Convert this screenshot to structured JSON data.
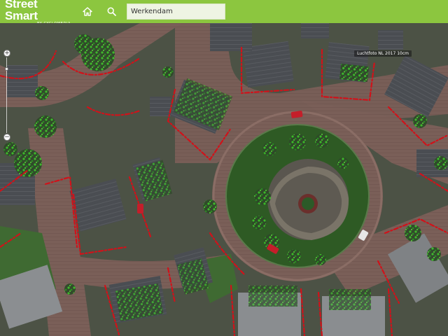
{
  "app": {
    "brand_name": "Street Smart",
    "brand_sub": "BY CYCLOMEDIA",
    "accent_color": "#8cc63f"
  },
  "toolbar": {
    "home_icon": "home-icon",
    "search_icon": "search-icon",
    "search_value": "Werkendam"
  },
  "map": {
    "attribution": "Luchtfoto NL 2017 10cm",
    "zoom_in_label": "+",
    "zoom_out_label": "−"
  }
}
